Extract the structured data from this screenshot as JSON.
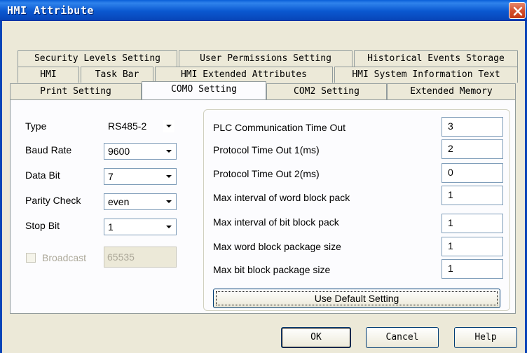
{
  "window": {
    "title": "HMI Attribute",
    "close_icon": "close-icon"
  },
  "tabs": {
    "row1": [
      "Security Levels Setting",
      "User Permissions Setting",
      "Historical Events Storage"
    ],
    "row2": [
      "HMI",
      "Task Bar",
      "HMI Extended Attributes",
      "HMI System Information Text"
    ],
    "row3": [
      "Print Setting",
      "COMO Setting",
      "COM2 Setting",
      "Extended Memory"
    ],
    "active": "COMO Setting"
  },
  "serial": {
    "type_label": "Type",
    "type_value": "RS485-2",
    "baud_label": "Baud Rate",
    "baud_value": "9600",
    "databit_label": "Data Bit",
    "databit_value": "7",
    "parity_label": "Parity Check",
    "parity_value": "even",
    "stopbit_label": "Stop Bit",
    "stopbit_value": "1",
    "broadcast_label": "Broadcast",
    "broadcast_value": "65535",
    "broadcast_checked": false
  },
  "timeouts": {
    "rows": [
      {
        "label": "PLC Communication Time Out",
        "value": "3"
      },
      {
        "label": "Protocol Time Out 1(ms)",
        "value": "2"
      },
      {
        "label": "Protocol Time Out 2(ms)",
        "value": "0"
      },
      {
        "label": "Max interval of word block pack",
        "value": "1"
      },
      {
        "label": "Max interval of bit block pack",
        "value": "1"
      },
      {
        "label": "Max word block package size",
        "value": "1"
      },
      {
        "label": "Max bit block package size",
        "value": "1"
      }
    ],
    "default_button": "Use Default Setting"
  },
  "buttons": {
    "ok": "OK",
    "cancel": "Cancel",
    "help": "Help"
  },
  "colors": {
    "titlebar": "#0a58d0",
    "dialog_bg": "#ece9d8",
    "close_button": "#d5502d"
  }
}
